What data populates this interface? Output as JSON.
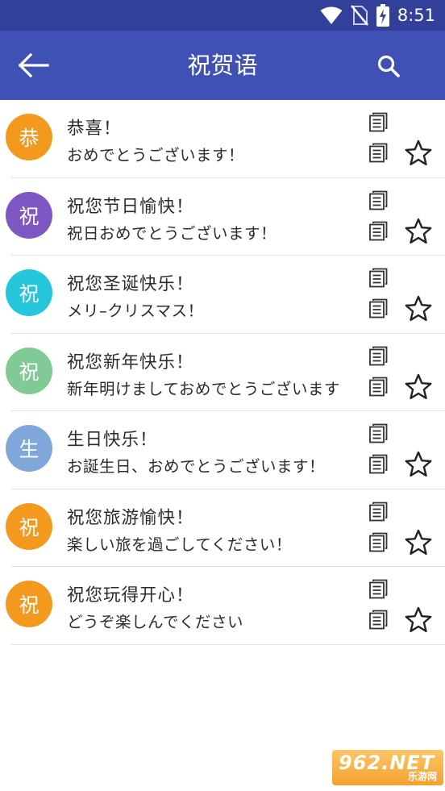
{
  "status_bar": {
    "time": "8:51",
    "icons": [
      "wifi-icon",
      "no-sim-icon",
      "battery-charging-icon"
    ]
  },
  "app_bar": {
    "back_icon": "arrow-left-icon",
    "title": "祝贺语",
    "search_icon": "search-icon"
  },
  "colors": {
    "status_bar": "#32409a",
    "app_bar": "#3f51b5"
  },
  "phrases": [
    {
      "avatar": "恭",
      "avatar_color": "#f39a1e",
      "chinese": "恭喜！",
      "japanese": "おめでとうございます！"
    },
    {
      "avatar": "祝",
      "avatar_color": "#7e57c2",
      "chinese": "祝您节日愉快！",
      "japanese": "祝日おめでとうございます！"
    },
    {
      "avatar": "祝",
      "avatar_color": "#26c6da",
      "chinese": "祝您圣诞快乐！",
      "japanese": "メリ–クリスマス！"
    },
    {
      "avatar": "祝",
      "avatar_color": "#81c995",
      "chinese": "祝您新年快乐！",
      "japanese": "新年明けましておめでとうございます"
    },
    {
      "avatar": "生",
      "avatar_color": "#7fa7da",
      "chinese": "生日快乐！",
      "japanese": "お誕生日、おめでとうございます！"
    },
    {
      "avatar": "祝",
      "avatar_color": "#f39a1e",
      "chinese": "祝您旅游愉快！",
      "japanese": "楽しい旅を過ごしてください！"
    },
    {
      "avatar": "祝",
      "avatar_color": "#f39a1e",
      "chinese": "祝您玩得开心！",
      "japanese": "どうぞ楽しんでください"
    }
  ],
  "row_icons": {
    "copy": "copy-icon",
    "favorite": "star-outline-icon"
  },
  "watermark": {
    "main": "962.NET",
    "sub": "乐游网"
  }
}
